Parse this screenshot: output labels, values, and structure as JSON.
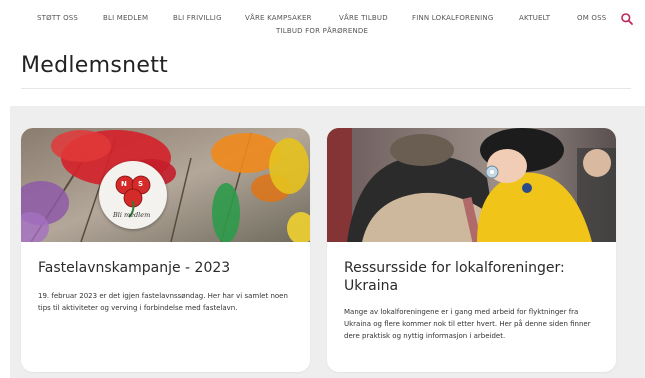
{
  "nav": {
    "items": [
      {
        "label": "STØTT OSS"
      },
      {
        "label": "BLI MEDLEM"
      },
      {
        "label": "BLI FRIVILLIG"
      },
      {
        "label": "VÅRE KAMPSAKER"
      },
      {
        "label": "VÅRE TILBUD"
      },
      {
        "label": "FINN LOKALFORENING"
      },
      {
        "label": "AKTUELT"
      },
      {
        "label": "OM OSS"
      },
      {
        "label": "TILBUD FOR PÅRØRENDE"
      }
    ],
    "search_icon": "search-icon",
    "accent_color": "#c0285a"
  },
  "page": {
    "title": "Medlemsnett"
  },
  "cards": [
    {
      "title": "Fastelavnskampanje - 2023",
      "text": "19. februar 2023 er det igjen fastelavnssøndag. Her har vi samlet noen tips til aktiviteter og verving i forbindelse med fastelavn.",
      "badge_text": "Bli medlem",
      "badge_letters": [
        "N",
        "S"
      ]
    },
    {
      "title": "Ressursside for lokalforeninger: Ukraina",
      "text": "Mange av lokalforeningene er i gang med arbeid for flyktninger fra Ukraina og flere kommer nok til etter hvert. Her på denne siden finner dere praktisk og nyttig informasjon i arbeidet."
    }
  ]
}
